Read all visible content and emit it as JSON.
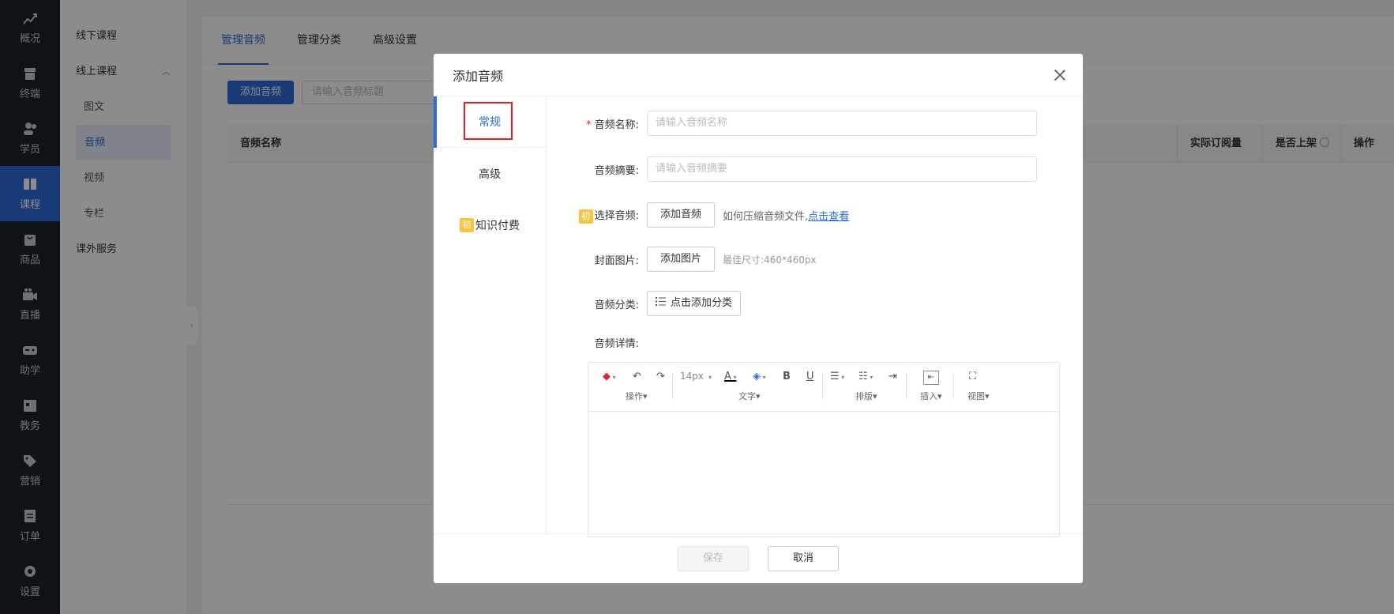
{
  "nav": {
    "items": [
      {
        "label": "概况",
        "icon": "chart-up-icon"
      },
      {
        "label": "终端",
        "icon": "store-icon"
      },
      {
        "label": "学员",
        "icon": "users-icon"
      },
      {
        "label": "课程",
        "icon": "book-icon"
      },
      {
        "label": "商品",
        "icon": "bag-icon"
      },
      {
        "label": "直播",
        "icon": "camera-icon"
      },
      {
        "label": "助学",
        "icon": "gamepad-icon"
      },
      {
        "label": "教务",
        "icon": "calendar-icon"
      },
      {
        "label": "营销",
        "icon": "tag-icon"
      },
      {
        "label": "订单",
        "icon": "document-icon"
      },
      {
        "label": "设置",
        "icon": "gear-icon"
      }
    ],
    "active_index": 3
  },
  "subnav": {
    "offline": "线下课程",
    "online": "线上课程",
    "online_items": [
      "图文",
      "音频",
      "视频",
      "专栏"
    ],
    "extra": "课外服务"
  },
  "main": {
    "tabs": [
      "管理音频",
      "管理分类",
      "高级设置"
    ],
    "add_button": "添加音频",
    "search_placeholder": "请输入音频标题",
    "columns": {
      "name": "音频名称",
      "subscribe": "实际订阅量",
      "listed": "是否上架",
      "action": "操作"
    }
  },
  "modal": {
    "title": "添加音频",
    "side_tabs": {
      "general": "常规",
      "advanced": "高级",
      "paid_badge": "初",
      "paid": "知识付费"
    },
    "fields": {
      "name_label": "音频名称:",
      "name_placeholder": "请输入音频名称",
      "summary_label": "音频摘要:",
      "summary_placeholder": "请输入音频摘要",
      "audio_badge": "初",
      "audio_label": "选择音频:",
      "audio_button": "添加音频",
      "audio_hint": "如何压缩音频文件,",
      "audio_link": "点击查看",
      "cover_label": "封面图片:",
      "cover_button": "添加图片",
      "cover_hint": "最佳尺寸:460*460px",
      "category_label": "音频分类:",
      "category_button": "点击添加分类",
      "detail_label": "音频详情:"
    },
    "editor": {
      "font_size": "14px",
      "groups": {
        "operate": "操作▾",
        "text": "文字▾",
        "layout": "排版▾",
        "insert": "插入▾",
        "view": "视图▾"
      }
    },
    "footer": {
      "save": "保存",
      "cancel": "取消"
    }
  }
}
